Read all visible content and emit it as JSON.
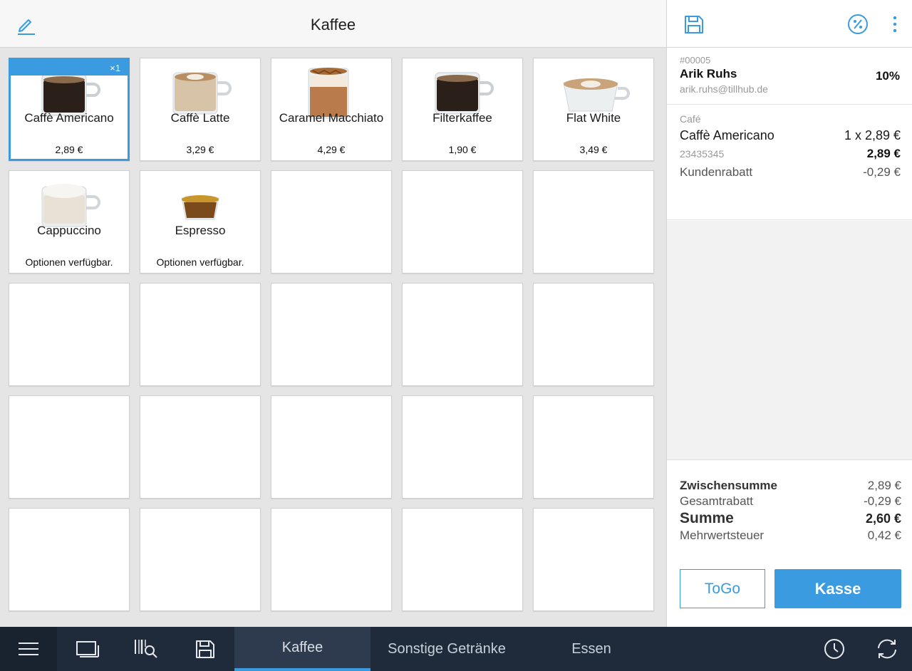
{
  "category_title": "Kaffee",
  "products": [
    {
      "name": "Caffè Americano",
      "price": "2,89 €",
      "badge": "×1",
      "selected": true,
      "img": "dark"
    },
    {
      "name": "Caffè Latte",
      "price": "3,29 €",
      "img": "latte"
    },
    {
      "name": "Caramel Macchiato",
      "price": "4,29 €",
      "img": "caramel"
    },
    {
      "name": "Filterkaffee",
      "price": "1,90 €",
      "img": "dark"
    },
    {
      "name": "Flat White",
      "price": "3,49 €",
      "img": "flat"
    },
    {
      "name": "Cappuccino",
      "price": "Optionen verfügbar.",
      "img": "cappuccino"
    },
    {
      "name": "Espresso",
      "price": "Optionen verfügbar.",
      "img": "espresso"
    }
  ],
  "customer": {
    "number": "#00005",
    "name": "Arik Ruhs",
    "discount": "10%",
    "email": "arik.ruhs@tillhub.de"
  },
  "cart": {
    "category": "Café",
    "item_name": "Caffè Americano",
    "item_qty_price": "1 x 2,89 €",
    "sku": "23435345",
    "item_total": "2,89 €",
    "discount_label": "Kundenrabatt",
    "discount_value": "-0,29 €"
  },
  "totals": {
    "subtotal_label": "Zwischensumme",
    "subtotal_value": "2,89 €",
    "total_discount_label": "Gesamtrabatt",
    "total_discount_value": "-0,29 €",
    "sum_label": "Summe",
    "sum_value": "2,60 €",
    "vat_label": "Mehrwertsteuer",
    "vat_value": "0,42 €"
  },
  "buttons": {
    "togo": "ToGo",
    "checkout": "Kasse"
  },
  "tabs": [
    {
      "label": "Kaffee",
      "active": true
    },
    {
      "label": "Sonstige Getränke",
      "active": false
    },
    {
      "label": "Essen",
      "active": false
    }
  ],
  "colors": {
    "accent": "#3a9be0",
    "bottom_bar": "#1f2a3a",
    "tab_active": "#2e3b4e"
  },
  "icons": [
    "edit-icon",
    "save-icon",
    "percent-icon",
    "more-vertical-icon",
    "menu-icon",
    "screen-icon",
    "barcode-search-icon",
    "save-icon",
    "clock-icon",
    "sync-icon"
  ]
}
